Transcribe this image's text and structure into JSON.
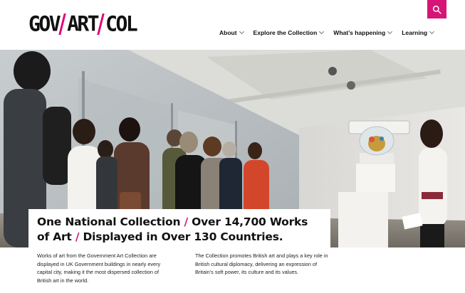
{
  "header": {
    "logo": {
      "part1": "GOV",
      "part2": "ART",
      "part3": "COL"
    },
    "search": {
      "icon": "search-icon",
      "accent_color": "#d61577"
    },
    "nav": [
      {
        "label": "About"
      },
      {
        "label": "Explore the Collection"
      },
      {
        "label": "What’s happening"
      },
      {
        "label": "Learning"
      }
    ]
  },
  "hero": {
    "headline": {
      "part1": "One National Collection",
      "sep1": "/",
      "part2": "Over 14,700 Works of Art",
      "sep2": "/",
      "part3": "Displayed in Over 130 Countries."
    }
  },
  "intro": {
    "left": "Works of art from the Government Art Collection are displayed in UK Government buildings in nearly every capital city, making it the most dispersed collection of British art in the world.",
    "right": "The Collection promotes British art and plays a key role in British cultural diplomacy, delivering an expression of Britain’s soft power, its culture and its values."
  }
}
